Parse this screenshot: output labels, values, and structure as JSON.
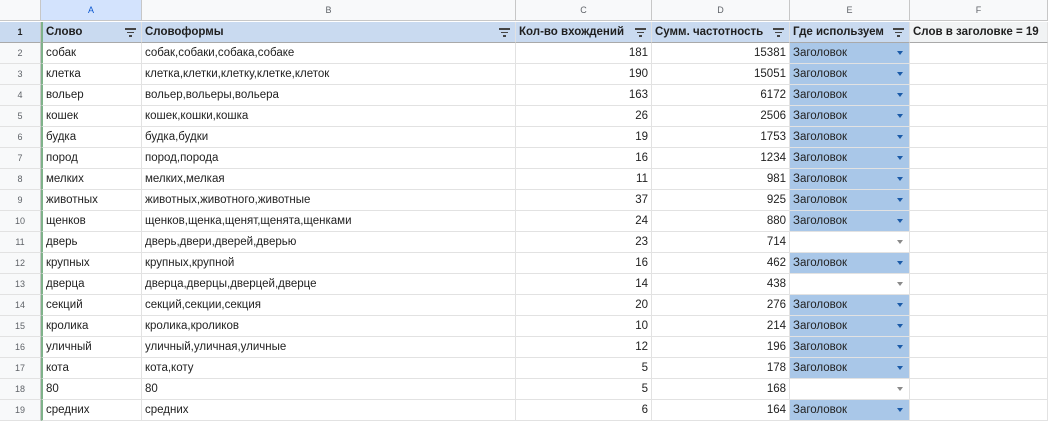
{
  "columns": [
    "A",
    "B",
    "C",
    "D",
    "E",
    "F"
  ],
  "header": {
    "word": "Слово",
    "forms": "Словоформы",
    "count": "Кол-во вхождений",
    "freq": "Сумм. частотность",
    "where": "Где используем",
    "title_count": "Слов в заголовке = 19"
  },
  "rows": [
    {
      "n": "1"
    },
    {
      "n": "2",
      "word": "собак",
      "forms": "собак,собаки,собака,собаке",
      "count": "181",
      "freq": "15381",
      "where": "Заголовок"
    },
    {
      "n": "3",
      "word": "клетка",
      "forms": "клетка,клетки,клетку,клетке,клеток",
      "count": "190",
      "freq": "15051",
      "where": "Заголовок"
    },
    {
      "n": "4",
      "word": "вольер",
      "forms": "вольер,вольеры,вольера",
      "count": "163",
      "freq": "6172",
      "where": "Заголовок"
    },
    {
      "n": "5",
      "word": "кошек",
      "forms": "кошек,кошки,кошка",
      "count": "26",
      "freq": "2506",
      "where": "Заголовок"
    },
    {
      "n": "6",
      "word": "будка",
      "forms": "будка,будки",
      "count": "19",
      "freq": "1753",
      "where": "Заголовок"
    },
    {
      "n": "7",
      "word": "пород",
      "forms": "пород,порода",
      "count": "16",
      "freq": "1234",
      "where": "Заголовок"
    },
    {
      "n": "8",
      "word": "мелких",
      "forms": "мелких,мелкая",
      "count": "11",
      "freq": "981",
      "where": "Заголовок"
    },
    {
      "n": "9",
      "word": "животных",
      "forms": "животных,животного,животные",
      "count": "37",
      "freq": "925",
      "where": "Заголовок"
    },
    {
      "n": "10",
      "word": "щенков",
      "forms": "щенков,щенка,щенят,щенята,щенками",
      "count": "24",
      "freq": "880",
      "where": "Заголовок"
    },
    {
      "n": "11",
      "word": "дверь",
      "forms": "дверь,двери,дверей,дверью",
      "count": "23",
      "freq": "714",
      "where": ""
    },
    {
      "n": "12",
      "word": "крупных",
      "forms": "крупных,крупной",
      "count": "16",
      "freq": "462",
      "where": "Заголовок"
    },
    {
      "n": "13",
      "word": "дверца",
      "forms": "дверца,дверцы,дверцей,дверце",
      "count": "14",
      "freq": "438",
      "where": ""
    },
    {
      "n": "14",
      "word": "секций",
      "forms": "секций,секции,секция",
      "count": "20",
      "freq": "276",
      "where": "Заголовок"
    },
    {
      "n": "15",
      "word": "кролика",
      "forms": "кролика,кроликов",
      "count": "10",
      "freq": "214",
      "where": "Заголовок"
    },
    {
      "n": "16",
      "word": "уличный",
      "forms": "уличный,уличная,уличные",
      "count": "12",
      "freq": "196",
      "where": "Заголовок"
    },
    {
      "n": "17",
      "word": "кота",
      "forms": "кота,коту",
      "count": "5",
      "freq": "178",
      "where": "Заголовок"
    },
    {
      "n": "18",
      "word": "80",
      "forms": "80",
      "count": "5",
      "freq": "168",
      "where": ""
    },
    {
      "n": "19",
      "word": "средних",
      "forms": "средних",
      "count": "6",
      "freq": "164",
      "where": "Заголовок"
    }
  ]
}
